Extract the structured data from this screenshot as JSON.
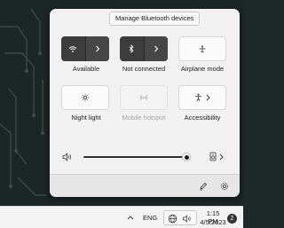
{
  "tooltip": "Manage Bluetooth devices",
  "quick_settings": {
    "tiles": [
      {
        "label": "Available",
        "icon": "wifi-icon",
        "state": "on",
        "has_chevron": true
      },
      {
        "label": "Not connected",
        "icon": "bluetooth-icon",
        "state": "on",
        "has_chevron": true
      },
      {
        "label": "Airplane mode",
        "icon": "airplane-icon",
        "state": "off",
        "has_chevron": false
      },
      {
        "label": "Night light",
        "icon": "night-light-icon",
        "state": "off",
        "has_chevron": false
      },
      {
        "label": "Mobile hotspot",
        "icon": "hotspot-icon",
        "state": "disabled",
        "has_chevron": false
      },
      {
        "label": "Accessibility",
        "icon": "accessibility-icon",
        "state": "off",
        "has_chevron": true
      }
    ],
    "volume": {
      "icon": "speaker-icon",
      "level": 1.0,
      "output_icon": "audio-output-icon"
    },
    "footer": {
      "edit_icon": "pencil-icon",
      "settings_icon": "gear-icon"
    }
  },
  "taskbar": {
    "overflow_icon": "chevron-up-icon",
    "language": "ENG",
    "network_icon": "globe-network-icon",
    "volume_icon": "speaker-icon",
    "time": "1:15 PM",
    "date": "4/5/2023",
    "notification_count": "2"
  },
  "colors": {
    "tile_on": "#3d3d3d",
    "panel_bg": "#f1f1f1",
    "taskbar_bg": "#f3f3f3"
  }
}
